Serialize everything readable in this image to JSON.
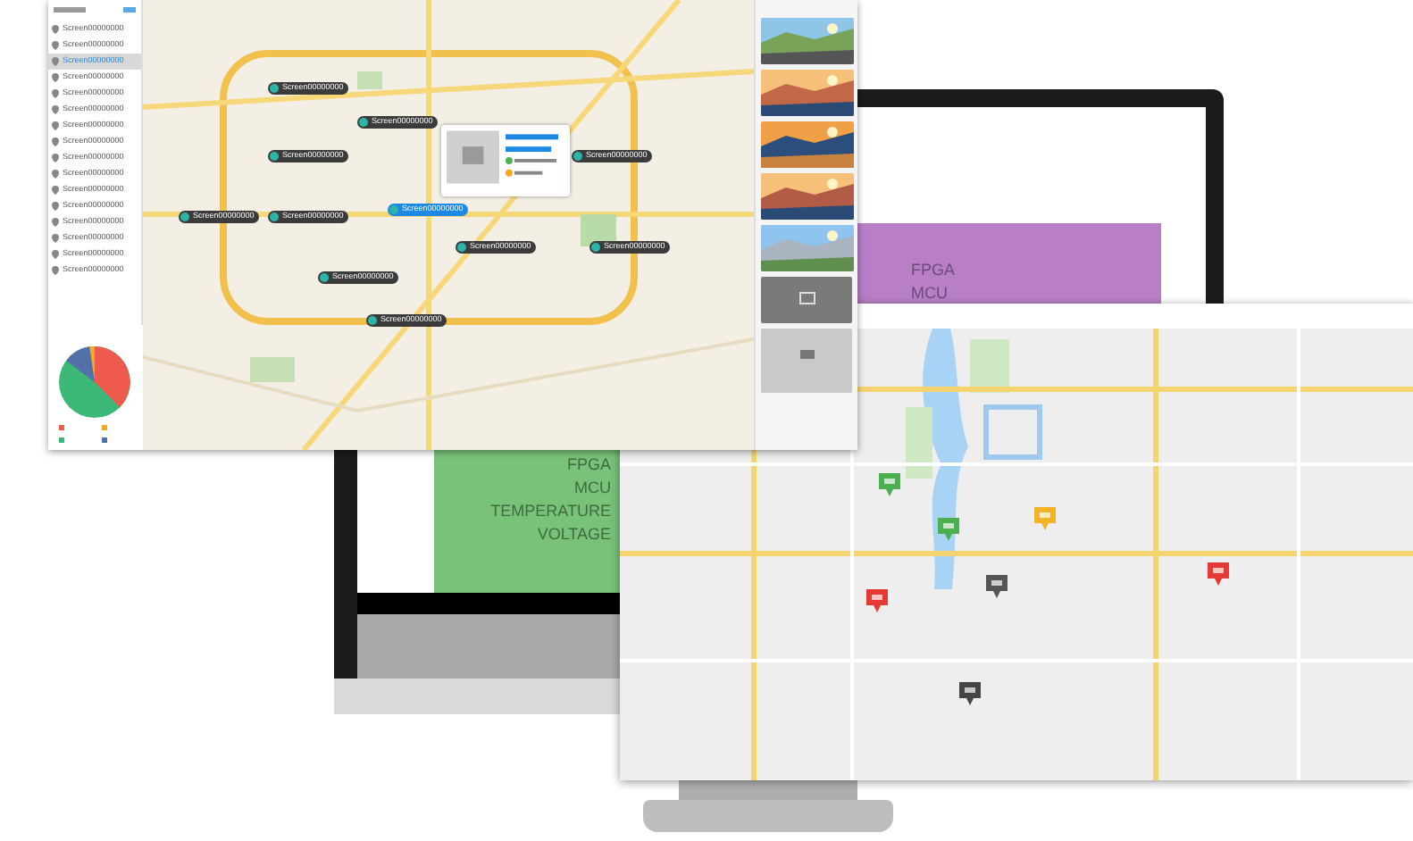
{
  "monitor": {
    "top_chart_labels": [
      "FPGA",
      "MCU"
    ],
    "side_chart_labels": [
      "FPGA",
      "MCU",
      "TEMPERATURE",
      "VOLTAGE"
    ]
  },
  "dashboard": {
    "device_list": [
      {
        "label": "Screen00000000",
        "selected": false
      },
      {
        "label": "Screen00000000",
        "selected": false
      },
      {
        "label": "Screen00000000",
        "selected": true
      },
      {
        "label": "Screen00000000",
        "selected": false
      },
      {
        "label": "Screen00000000",
        "selected": false
      },
      {
        "label": "Screen00000000",
        "selected": false
      },
      {
        "label": "Screen00000000",
        "selected": false
      },
      {
        "label": "Screen00000000",
        "selected": false
      },
      {
        "label": "Screen00000000",
        "selected": false
      },
      {
        "label": "Screen00000000",
        "selected": false
      },
      {
        "label": "Screen00000000",
        "selected": false
      },
      {
        "label": "Screen00000000",
        "selected": false
      },
      {
        "label": "Screen00000000",
        "selected": false
      },
      {
        "label": "Screen00000000",
        "selected": false
      },
      {
        "label": "Screen00000000",
        "selected": false
      },
      {
        "label": "Screen00000000",
        "selected": false
      }
    ],
    "map_markers": [
      {
        "label": "Screen00000000",
        "selected": false
      },
      {
        "label": "Screen00000000",
        "selected": false
      },
      {
        "label": "Screen00000000",
        "selected": false
      },
      {
        "label": "Screen00000000",
        "selected": false
      },
      {
        "label": "Screen00000000",
        "selected": false
      },
      {
        "label": "Screen00000000",
        "selected": false
      },
      {
        "label": "Screen00000000",
        "selected": true
      },
      {
        "label": "Screen00000000",
        "selected": false
      },
      {
        "label": "Screen00000000",
        "selected": false
      },
      {
        "label": "Screen00000000",
        "selected": false
      },
      {
        "label": "Screen00000000",
        "selected": false
      }
    ],
    "video_tiles": [
      {
        "kind": "picture"
      },
      {
        "kind": "picture"
      },
      {
        "kind": "picture"
      },
      {
        "kind": "picture"
      },
      {
        "kind": "picture"
      },
      {
        "kind": "offline"
      },
      {
        "kind": "empty"
      }
    ]
  },
  "city_map": {
    "markers": [
      {
        "color": "#4caf50"
      },
      {
        "color": "#4caf50"
      },
      {
        "color": "#f0b429"
      },
      {
        "color": "#555555"
      },
      {
        "color": "#e53935"
      },
      {
        "color": "#e53935"
      },
      {
        "color": "#444444"
      }
    ]
  }
}
